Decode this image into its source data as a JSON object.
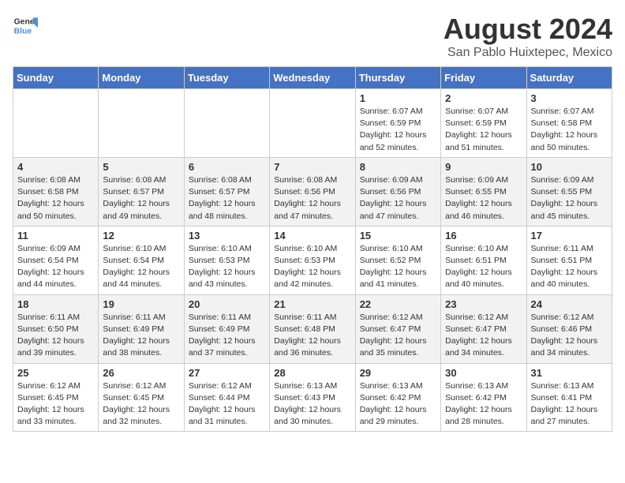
{
  "header": {
    "logo_line1": "General",
    "logo_line2": "Blue",
    "month_year": "August 2024",
    "location": "San Pablo Huixtepec, Mexico"
  },
  "weekdays": [
    "Sunday",
    "Monday",
    "Tuesday",
    "Wednesday",
    "Thursday",
    "Friday",
    "Saturday"
  ],
  "weeks": [
    [
      {
        "day": "",
        "info": ""
      },
      {
        "day": "",
        "info": ""
      },
      {
        "day": "",
        "info": ""
      },
      {
        "day": "",
        "info": ""
      },
      {
        "day": "1",
        "info": "Sunrise: 6:07 AM\nSunset: 6:59 PM\nDaylight: 12 hours\nand 52 minutes."
      },
      {
        "day": "2",
        "info": "Sunrise: 6:07 AM\nSunset: 6:59 PM\nDaylight: 12 hours\nand 51 minutes."
      },
      {
        "day": "3",
        "info": "Sunrise: 6:07 AM\nSunset: 6:58 PM\nDaylight: 12 hours\nand 50 minutes."
      }
    ],
    [
      {
        "day": "4",
        "info": "Sunrise: 6:08 AM\nSunset: 6:58 PM\nDaylight: 12 hours\nand 50 minutes."
      },
      {
        "day": "5",
        "info": "Sunrise: 6:08 AM\nSunset: 6:57 PM\nDaylight: 12 hours\nand 49 minutes."
      },
      {
        "day": "6",
        "info": "Sunrise: 6:08 AM\nSunset: 6:57 PM\nDaylight: 12 hours\nand 48 minutes."
      },
      {
        "day": "7",
        "info": "Sunrise: 6:08 AM\nSunset: 6:56 PM\nDaylight: 12 hours\nand 47 minutes."
      },
      {
        "day": "8",
        "info": "Sunrise: 6:09 AM\nSunset: 6:56 PM\nDaylight: 12 hours\nand 47 minutes."
      },
      {
        "day": "9",
        "info": "Sunrise: 6:09 AM\nSunset: 6:55 PM\nDaylight: 12 hours\nand 46 minutes."
      },
      {
        "day": "10",
        "info": "Sunrise: 6:09 AM\nSunset: 6:55 PM\nDaylight: 12 hours\nand 45 minutes."
      }
    ],
    [
      {
        "day": "11",
        "info": "Sunrise: 6:09 AM\nSunset: 6:54 PM\nDaylight: 12 hours\nand 44 minutes."
      },
      {
        "day": "12",
        "info": "Sunrise: 6:10 AM\nSunset: 6:54 PM\nDaylight: 12 hours\nand 44 minutes."
      },
      {
        "day": "13",
        "info": "Sunrise: 6:10 AM\nSunset: 6:53 PM\nDaylight: 12 hours\nand 43 minutes."
      },
      {
        "day": "14",
        "info": "Sunrise: 6:10 AM\nSunset: 6:53 PM\nDaylight: 12 hours\nand 42 minutes."
      },
      {
        "day": "15",
        "info": "Sunrise: 6:10 AM\nSunset: 6:52 PM\nDaylight: 12 hours\nand 41 minutes."
      },
      {
        "day": "16",
        "info": "Sunrise: 6:10 AM\nSunset: 6:51 PM\nDaylight: 12 hours\nand 40 minutes."
      },
      {
        "day": "17",
        "info": "Sunrise: 6:11 AM\nSunset: 6:51 PM\nDaylight: 12 hours\nand 40 minutes."
      }
    ],
    [
      {
        "day": "18",
        "info": "Sunrise: 6:11 AM\nSunset: 6:50 PM\nDaylight: 12 hours\nand 39 minutes."
      },
      {
        "day": "19",
        "info": "Sunrise: 6:11 AM\nSunset: 6:49 PM\nDaylight: 12 hours\nand 38 minutes."
      },
      {
        "day": "20",
        "info": "Sunrise: 6:11 AM\nSunset: 6:49 PM\nDaylight: 12 hours\nand 37 minutes."
      },
      {
        "day": "21",
        "info": "Sunrise: 6:11 AM\nSunset: 6:48 PM\nDaylight: 12 hours\nand 36 minutes."
      },
      {
        "day": "22",
        "info": "Sunrise: 6:12 AM\nSunset: 6:47 PM\nDaylight: 12 hours\nand 35 minutes."
      },
      {
        "day": "23",
        "info": "Sunrise: 6:12 AM\nSunset: 6:47 PM\nDaylight: 12 hours\nand 34 minutes."
      },
      {
        "day": "24",
        "info": "Sunrise: 6:12 AM\nSunset: 6:46 PM\nDaylight: 12 hours\nand 34 minutes."
      }
    ],
    [
      {
        "day": "25",
        "info": "Sunrise: 6:12 AM\nSunset: 6:45 PM\nDaylight: 12 hours\nand 33 minutes."
      },
      {
        "day": "26",
        "info": "Sunrise: 6:12 AM\nSunset: 6:45 PM\nDaylight: 12 hours\nand 32 minutes."
      },
      {
        "day": "27",
        "info": "Sunrise: 6:12 AM\nSunset: 6:44 PM\nDaylight: 12 hours\nand 31 minutes."
      },
      {
        "day": "28",
        "info": "Sunrise: 6:13 AM\nSunset: 6:43 PM\nDaylight: 12 hours\nand 30 minutes."
      },
      {
        "day": "29",
        "info": "Sunrise: 6:13 AM\nSunset: 6:42 PM\nDaylight: 12 hours\nand 29 minutes."
      },
      {
        "day": "30",
        "info": "Sunrise: 6:13 AM\nSunset: 6:42 PM\nDaylight: 12 hours\nand 28 minutes."
      },
      {
        "day": "31",
        "info": "Sunrise: 6:13 AM\nSunset: 6:41 PM\nDaylight: 12 hours\nand 27 minutes."
      }
    ]
  ]
}
